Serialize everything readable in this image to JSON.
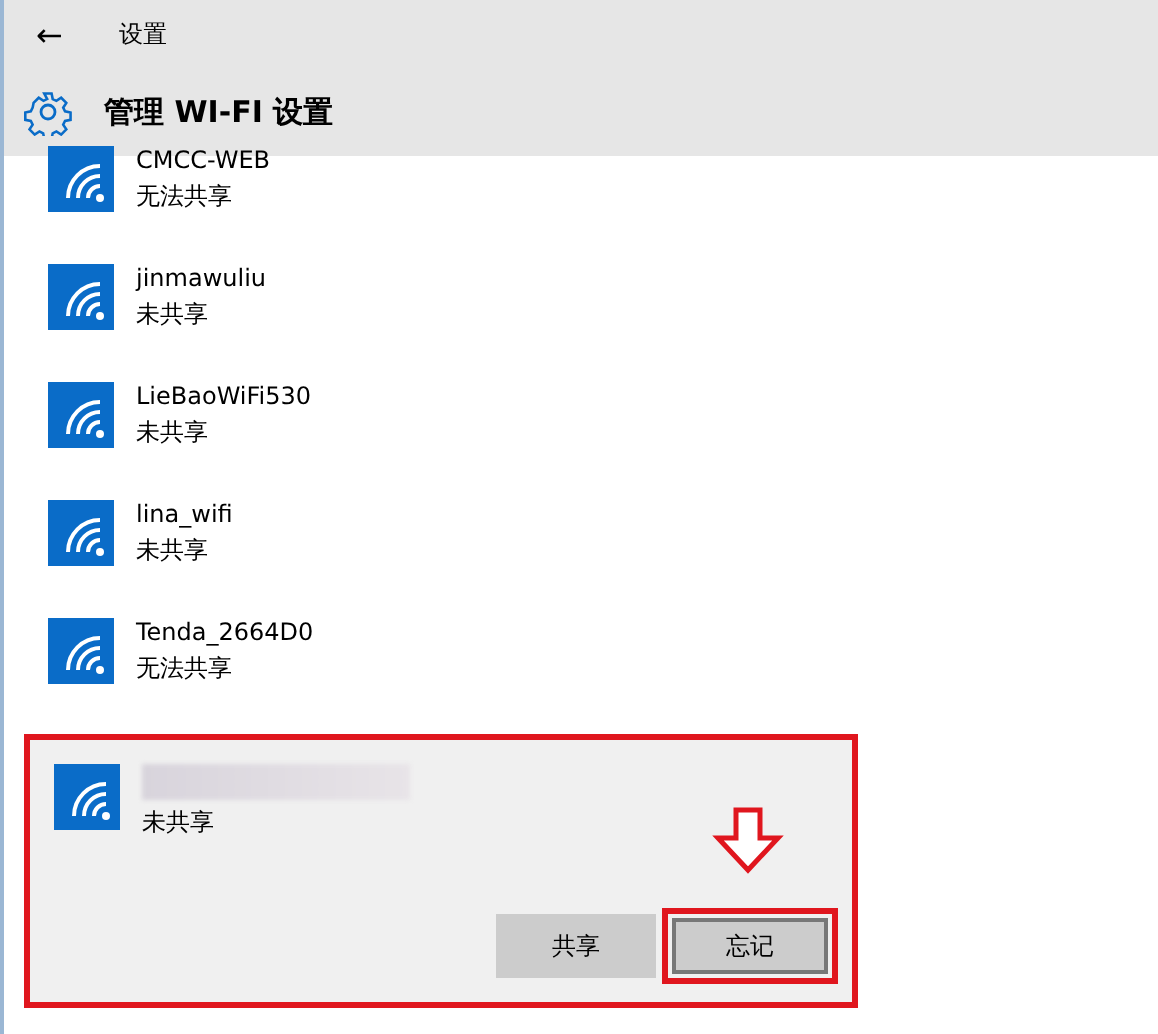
{
  "window": {
    "title": "设置",
    "back": "←"
  },
  "header": {
    "title": "管理 WI-FI 设置"
  },
  "networks": [
    {
      "name": "CMCC-WEB",
      "status": "无法共享",
      "selected": false,
      "name_hidden": false
    },
    {
      "name": "jinmawuliu",
      "status": "未共享",
      "selected": false,
      "name_hidden": false
    },
    {
      "name": "LieBaoWiFi530",
      "status": "未共享",
      "selected": false,
      "name_hidden": false
    },
    {
      "name": "lina_wifi",
      "status": "未共享",
      "selected": false,
      "name_hidden": false
    },
    {
      "name": "Tenda_2664D0",
      "status": "无法共享",
      "selected": false,
      "name_hidden": false
    },
    {
      "status": "未共享",
      "selected": true,
      "name_hidden": true,
      "buttons": [
        {
          "label": "共享",
          "highlighted": false
        },
        {
          "label": "忘记",
          "highlighted": true
        }
      ]
    }
  ]
}
